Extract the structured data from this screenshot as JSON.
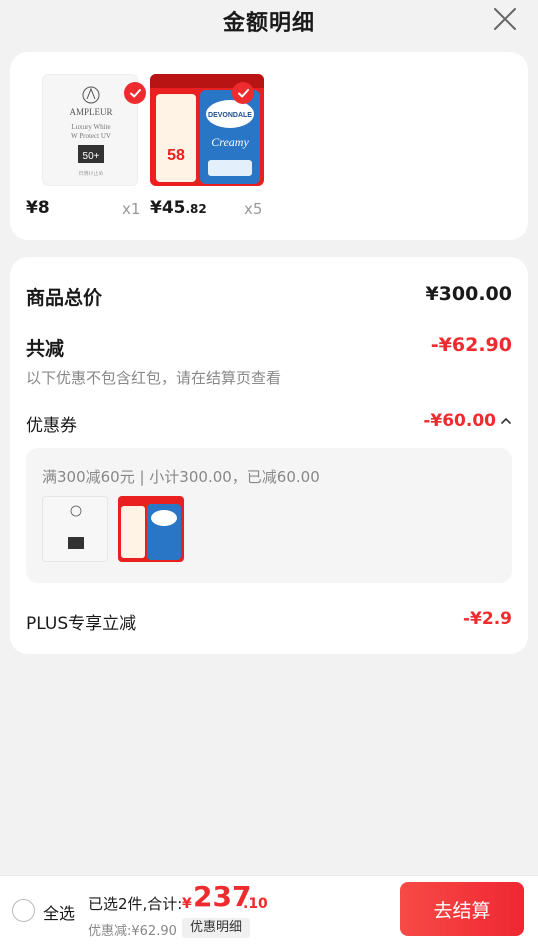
{
  "header": {
    "title": "金额明细"
  },
  "products": [
    {
      "price": "¥8",
      "price_decimal": "",
      "qty": "x1",
      "brand": "AMPLEUR",
      "line1": "Luxury White",
      "line2": "W Protect UV",
      "spf": "50+",
      "foot": "日焼け止め"
    },
    {
      "price": "¥45",
      "price_decimal": ".82",
      "qty": "x5",
      "brand": "DEVONDALE",
      "line1": "Creamy",
      "badge": "58"
    }
  ],
  "summary": {
    "total_label": "商品总价",
    "total_value": "¥300.00",
    "reduce_label": "共减",
    "reduce_value": "-¥62.90",
    "reduce_note": "以下优惠不包含红包，请在结算页查看",
    "coupon_label": "优惠券",
    "coupon_value": "-¥60.00",
    "coupon_desc": "满300减60元 | 小计300.00，已减60.00",
    "plus_label": "PLUS专享立减",
    "plus_value": "-¥2.9"
  },
  "footer": {
    "select_all": "全选",
    "selected_info": "已选2件,合计:",
    "currency": "¥",
    "total_int": "237",
    "total_dec": ".10",
    "discount_text": "优惠减:¥62.90",
    "detail_button": "优惠明细",
    "checkout_button": "去结算"
  },
  "colors": {
    "accent": "#ee2b2e",
    "background": "#f2f2f2"
  }
}
